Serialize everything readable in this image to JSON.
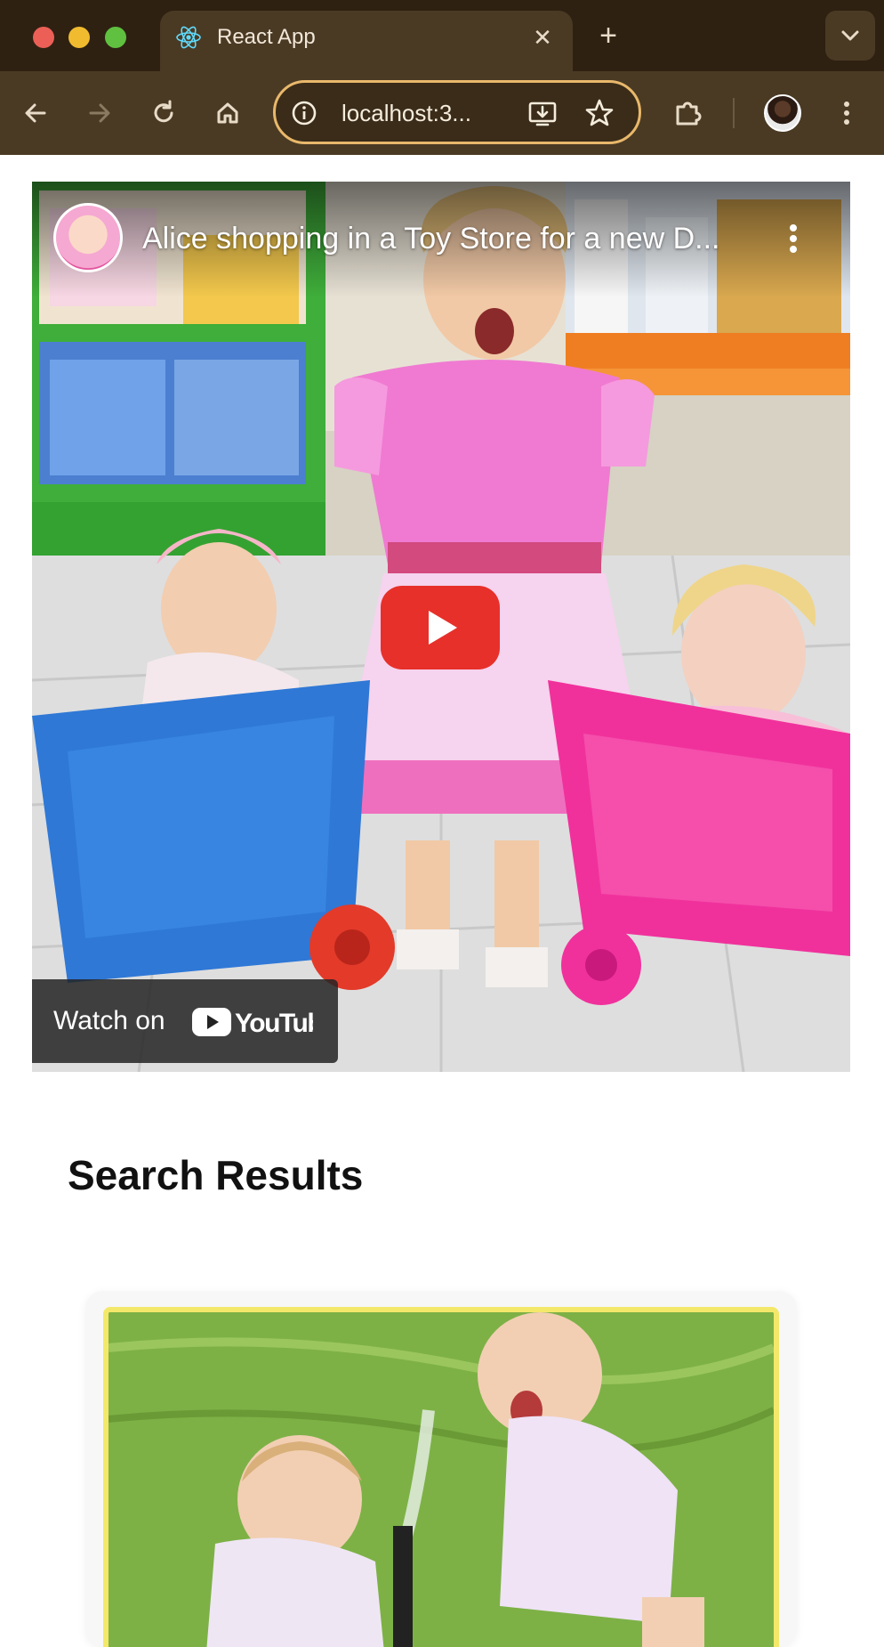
{
  "browser": {
    "tab_title": "React App",
    "url": "localhost:3...",
    "colors": {
      "chrome_dark": "#2e2112",
      "chrome": "#4a3a24",
      "omnibox_border": "#e9b86b"
    }
  },
  "video": {
    "title": "Alice shopping in a Toy Store for a new D...",
    "watch_on_label": "Watch on",
    "platform": "YouTube"
  },
  "results": {
    "heading": "Search Results"
  }
}
